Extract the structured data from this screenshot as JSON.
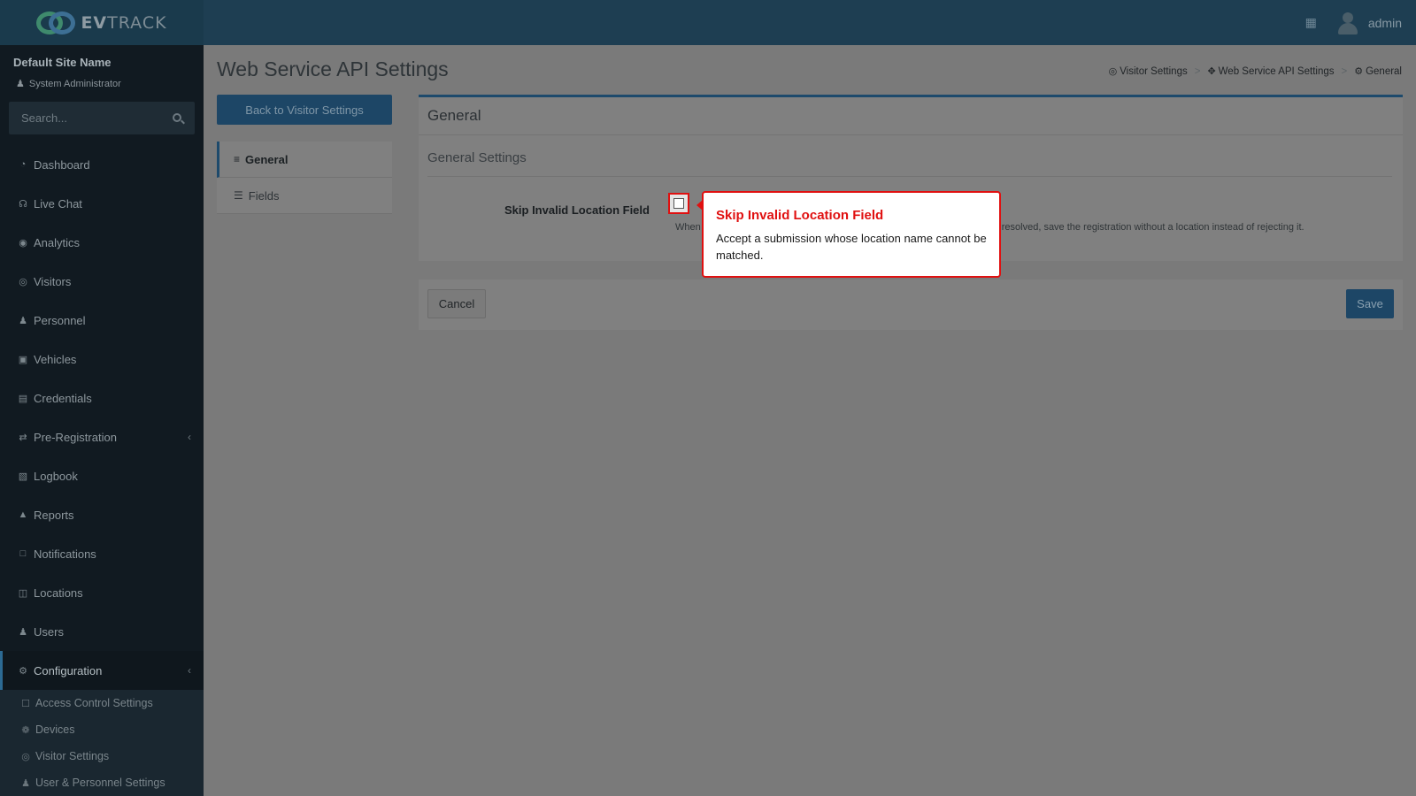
{
  "header": {
    "brand_bold": "EV",
    "brand_rest": "TRACK",
    "username": "admin"
  },
  "sidebar": {
    "site_name": "Default Site Name",
    "site_role": "System Administrator",
    "search_placeholder": "Search...",
    "items": [
      {
        "label": "Dashboard",
        "icon": "dashboard-icon"
      },
      {
        "label": "Live Chat",
        "icon": "headset-icon"
      },
      {
        "label": "Analytics",
        "icon": "target-icon"
      },
      {
        "label": "Visitors",
        "icon": "eye-icon"
      },
      {
        "label": "Personnel",
        "icon": "person-icon"
      },
      {
        "label": "Vehicles",
        "icon": "car-icon"
      },
      {
        "label": "Credentials",
        "icon": "badge-icon"
      },
      {
        "label": "Pre-Registration",
        "icon": "arrows-icon"
      },
      {
        "label": "Logbook",
        "icon": "book-icon"
      },
      {
        "label": "Reports",
        "icon": "chart-icon"
      },
      {
        "label": "Notifications",
        "icon": "chat-icon"
      },
      {
        "label": "Locations",
        "icon": "map-icon"
      },
      {
        "label": "Users",
        "icon": "users-icon"
      },
      {
        "label": "Configuration",
        "icon": "gear-icon"
      }
    ],
    "sub_items": [
      {
        "label": "Access Control Settings",
        "icon": "lock-icon"
      },
      {
        "label": "Devices",
        "icon": "device-icon"
      },
      {
        "label": "Visitor Settings",
        "icon": "eye-icon"
      },
      {
        "label": "User & Personnel Settings",
        "icon": "users-icon"
      }
    ]
  },
  "page": {
    "title": "Web Service API Settings",
    "breadcrumb": [
      "Visitor Settings",
      "Web Service API Settings",
      "General"
    ],
    "back_label": "Back to Visitor Settings",
    "tabs": [
      "General",
      "Fields"
    ],
    "card_title": "General",
    "section_title": "General Settings",
    "field_label": "Skip Invalid Location Field",
    "field_checked": false,
    "help_start": "When",
    "help_end": "resolved, save the registration without a location instead of rejecting it.",
    "cancel_label": "Cancel",
    "save_label": "Save"
  },
  "tooltip": {
    "title": "Skip Invalid Location Field",
    "body": "Accept a submission whose location name cannot be matched."
  },
  "colors": {
    "accent": "#1d4666",
    "highlight": "#e01010"
  }
}
